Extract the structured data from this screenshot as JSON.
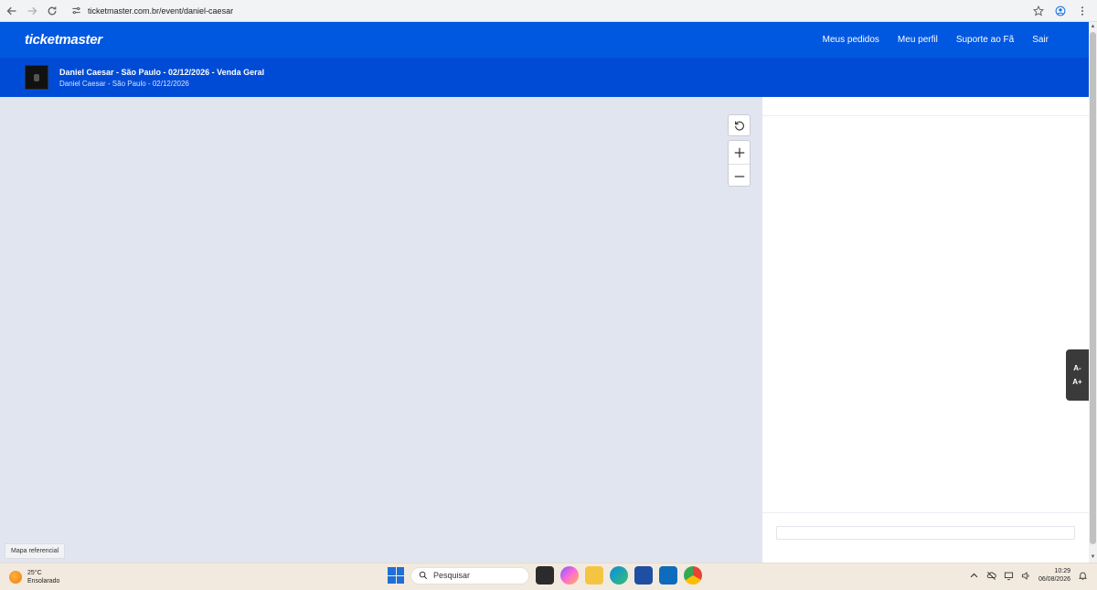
{
  "browser": {
    "url": "ticketmaster.com.br/event/daniel-caesar"
  },
  "header": {
    "logo": "ticketmaster",
    "nav": [
      {
        "label": "Meus pedidos"
      },
      {
        "label": "Meu perfil"
      },
      {
        "label": "Suporte ao Fã"
      },
      {
        "label": "Sair"
      }
    ]
  },
  "event": {
    "title": "Daniel Caesar - São Paulo - 02/12/2026 - Venda Geral",
    "subtitle": "Daniel Caesar - São Paulo - 02/12/2026"
  },
  "map": {
    "reference_label": "Mapa referencial"
  },
  "font_controls": {
    "decrease": "A-",
    "increase": "A+"
  },
  "taskbar": {
    "weather_temp": "25°C",
    "weather_desc": "Ensolarado",
    "search_placeholder": "Pesquisar",
    "time": "10:29",
    "date": "06/08/2026"
  },
  "colors": {
    "header_blue": "#0057e0",
    "event_bar_blue": "#004bd6",
    "map_bg": "#e1e5ef"
  }
}
